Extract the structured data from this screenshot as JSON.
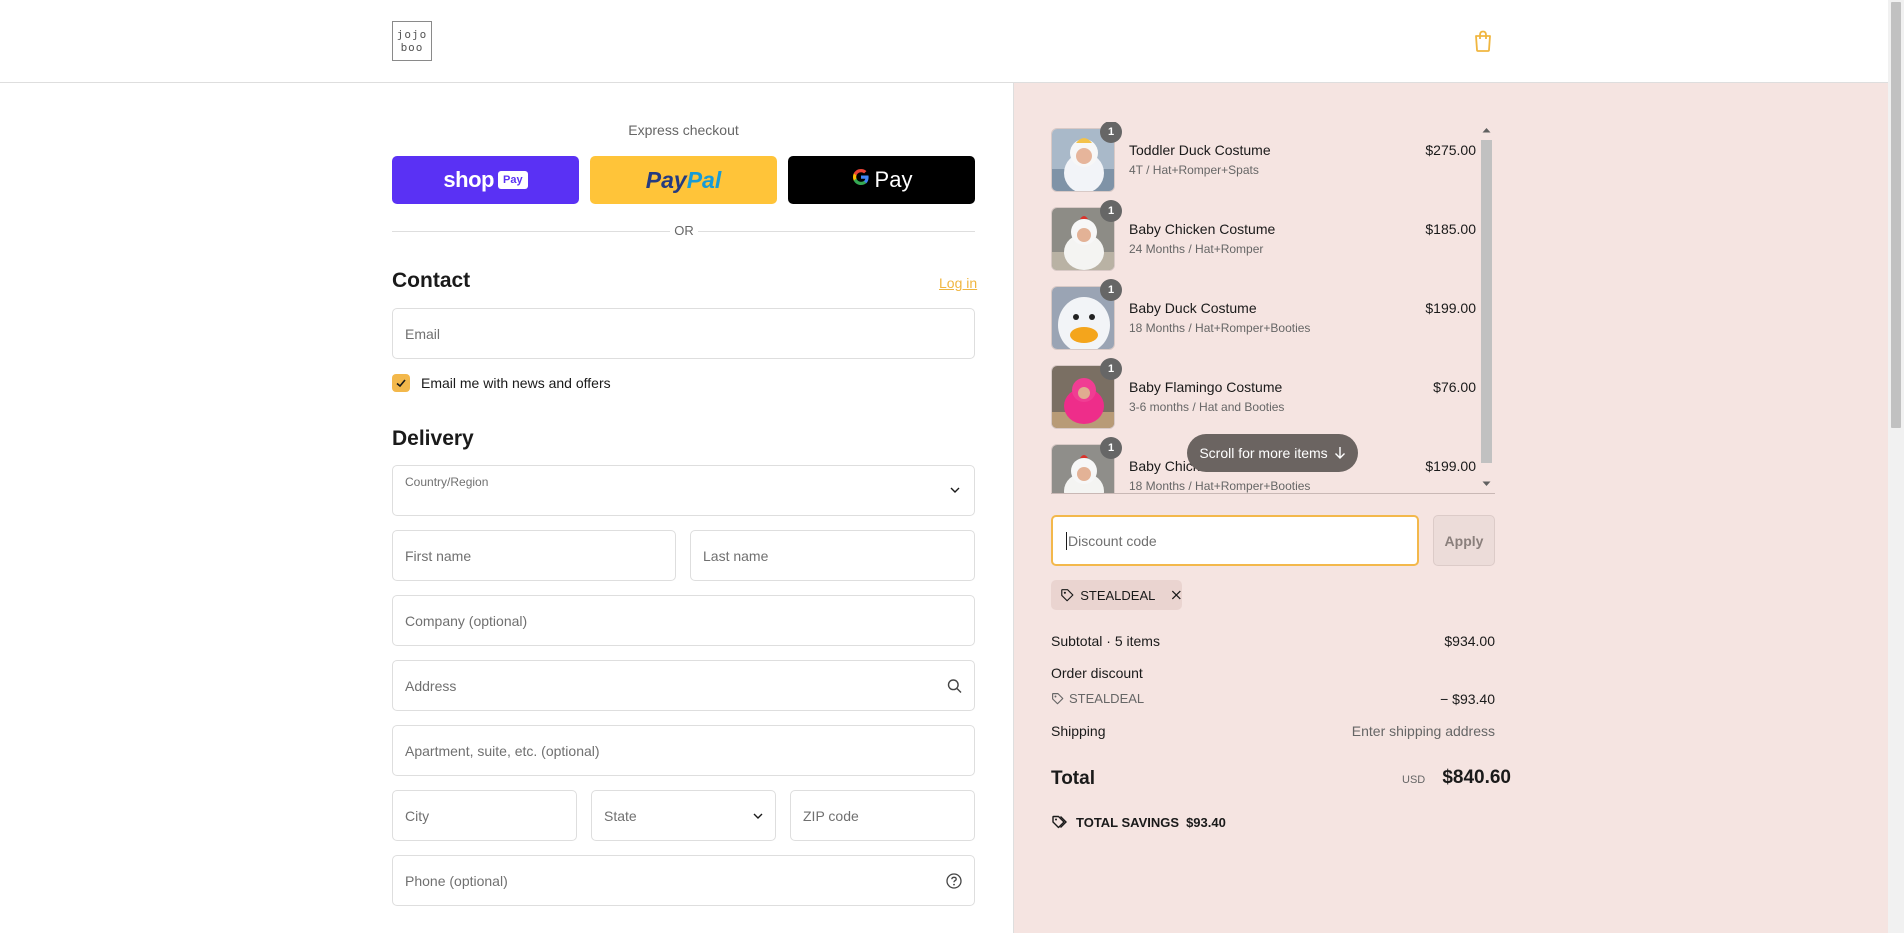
{
  "header": {
    "logo_line1": "jojo",
    "logo_line2": "boo"
  },
  "express": {
    "label": "Express checkout",
    "shop_pay_text": "shop",
    "shop_pay_pill": "Pay",
    "paypal_text1": "Pay",
    "paypal_text2": "Pal",
    "gpay_text": "Pay",
    "or": "OR"
  },
  "contact": {
    "title": "Contact",
    "login": "Log in",
    "email_placeholder": "Email",
    "newsletter_label": "Email me with news and offers",
    "newsletter_checked": true
  },
  "delivery": {
    "title": "Delivery",
    "country_label": "Country/Region",
    "first_name": "First name",
    "last_name": "Last name",
    "company": "Company (optional)",
    "address": "Address",
    "apartment": "Apartment, suite, etc. (optional)",
    "city": "City",
    "state": "State",
    "zip": "ZIP code",
    "phone": "Phone (optional)"
  },
  "items": [
    {
      "name": "Toddler Duck Costume",
      "variant": "4T / Hat+Romper+Spats",
      "price": "$275.00",
      "qty": "1"
    },
    {
      "name": "Baby Chicken Costume",
      "variant": "24 Months / Hat+Romper",
      "price": "$185.00",
      "qty": "1"
    },
    {
      "name": "Baby Duck Costume",
      "variant": "18 Months / Hat+Romper+Booties",
      "price": "$199.00",
      "qty": "1"
    },
    {
      "name": "Baby Flamingo Costume",
      "variant": "3-6 months / Hat and Booties",
      "price": "$76.00",
      "qty": "1"
    },
    {
      "name": "Baby Chick",
      "variant": "18 Months / Hat+Romper+Booties",
      "price": "$199.00",
      "qty": "1"
    }
  ],
  "scroll_more": "Scroll for more items",
  "discount": {
    "placeholder": "Discount code",
    "apply": "Apply",
    "applied_code": "STEALDEAL"
  },
  "summary": {
    "subtotal_label": "Subtotal · 5 items",
    "subtotal_value": "$934.00",
    "order_discount_label": "Order discount",
    "discount_code": "STEALDEAL",
    "discount_value": "− $93.40",
    "shipping_label": "Shipping",
    "shipping_value": "Enter shipping address",
    "total_label": "Total",
    "currency": "USD",
    "total_value": "$840.60",
    "savings_label": "TOTAL SAVINGS",
    "savings_value": "$93.40"
  },
  "colors": {
    "accent": "#f3b84b",
    "shop_pay": "#5a31f4",
    "paypal": "#ffc439",
    "summary_bg": "#f5e4e1"
  }
}
